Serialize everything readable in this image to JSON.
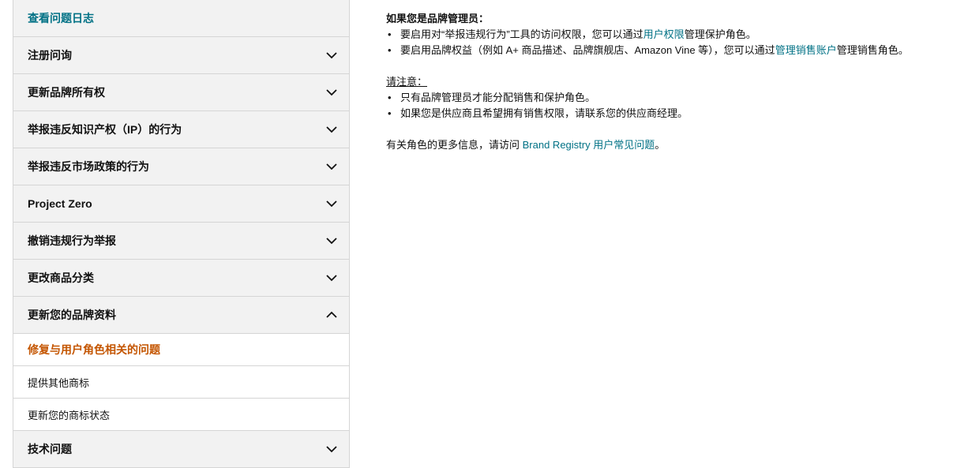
{
  "sidebar": {
    "items": [
      {
        "label": "查看问题日志",
        "chevron": "none"
      },
      {
        "label": "注册问询",
        "chevron": "down"
      },
      {
        "label": "更新品牌所有权",
        "chevron": "down"
      },
      {
        "label": "举报违反知识产权（IP）的行为",
        "chevron": "down"
      },
      {
        "label": "举报违反市场政策的行为",
        "chevron": "down"
      },
      {
        "label": "Project Zero",
        "chevron": "down"
      },
      {
        "label": "撤销违规行为举报",
        "chevron": "down"
      },
      {
        "label": "更改商品分类",
        "chevron": "down"
      },
      {
        "label": "更新您的品牌资料",
        "chevron": "up"
      }
    ],
    "sub_items": [
      {
        "label": "修复与用户角色相关的问题",
        "active": true
      },
      {
        "label": "提供其他商标",
        "active": false
      },
      {
        "label": "更新您的商标状态",
        "active": false
      }
    ],
    "last_item": {
      "label": "技术问题",
      "chevron": "down"
    }
  },
  "content": {
    "heading": "如果您是品牌管理员：",
    "bullets1": [
      {
        "pre": "要启用对“举报违规行为”工具的访问权限，您可以通过",
        "link": "用户权限",
        "post": "管理保护角色。"
      },
      {
        "pre": "要启用品牌权益（例如 A+ 商品描述、品牌旗舰店、Amazon Vine 等），您可以通过",
        "link": "管理销售账户",
        "post": "管理销售角色。"
      }
    ],
    "note_heading": "请注意：",
    "bullets2": [
      "只有品牌管理员才能分配销售和保护角色。",
      "如果您是供应商且希望拥有销售权限，请联系您的供应商经理。"
    ],
    "footer": {
      "pre": "有关角色的更多信息，请访问 ",
      "link": "Brand Registry 用户常见问题",
      "post": "。"
    }
  },
  "colors": {
    "link": "#007185",
    "active": "#c45500",
    "panel": "#f2f2f2",
    "border": "#d5d5d5"
  }
}
